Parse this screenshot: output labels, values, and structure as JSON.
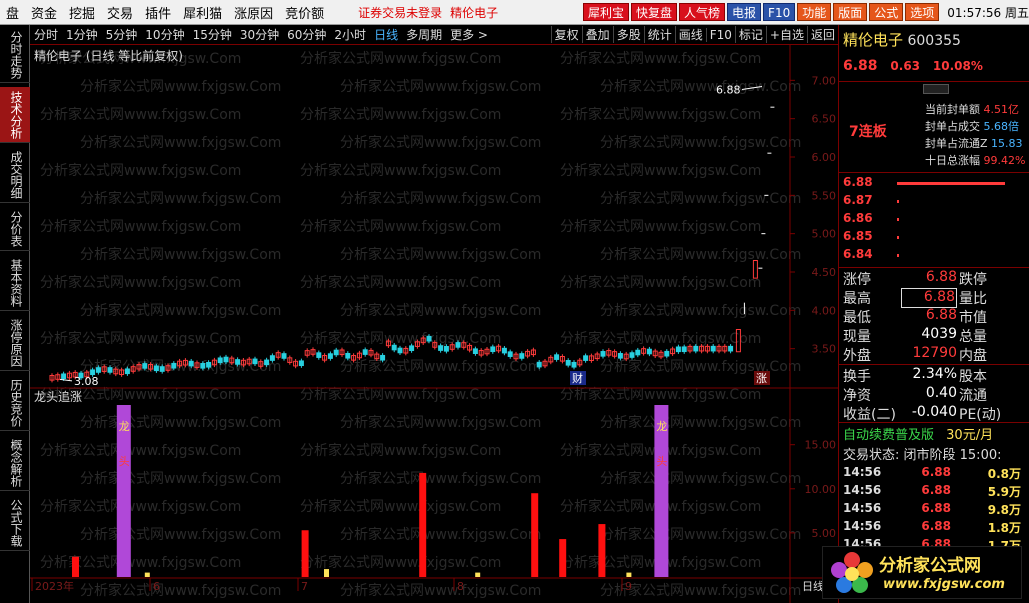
{
  "menu": {
    "items": [
      "盘",
      "资金",
      "挖掘",
      "交易",
      "插件",
      "犀利猫",
      "涨原因",
      "竞价额"
    ],
    "warning": "证券交易未登录",
    "stock_name": "精伦电子",
    "toolbar_buttons": [
      "犀利宝",
      "快复盘",
      "人气榜",
      "电报",
      "F10",
      "功能",
      "版面",
      "公式",
      "选项"
    ],
    "clock": "01:57:56 周五"
  },
  "left_tabs": [
    "分时走势",
    "技术分析",
    "成交明细",
    "分价表",
    "基本资料",
    "涨停原因",
    "历史竞价",
    "概念解析",
    "公式下载"
  ],
  "period_tabs": [
    "分时",
    "1分钟",
    "5分钟",
    "10分钟",
    "15分钟",
    "30分钟",
    "60分钟",
    "2小时",
    "日线",
    "多周期",
    "更多 >"
  ],
  "active_period": "日线",
  "right_buttons": [
    "复权",
    "叠加",
    "多股",
    "统计",
    "画线",
    "F10",
    "标记",
    "+自选",
    "返回"
  ],
  "chart": {
    "title": "精伦电子 (日线 等比前复权)",
    "sub_title": "龙头追涨",
    "label_high": "6.88",
    "label_low": "3.08",
    "marker_cai": "财",
    "marker_zhang": "涨",
    "marker_long": "龙",
    "marker_tou": "头",
    "x_labels": [
      "2023年",
      "6",
      "7",
      "8",
      "9"
    ],
    "x_right_label": "日线",
    "watermark": "分析家公式网www.fxjgsw.Com"
  },
  "chart_data": {
    "type": "candlestick",
    "price_axis": {
      "ticks": [
        3.5,
        4.0,
        4.5,
        5.0,
        5.5,
        6.0,
        6.5,
        7.0
      ],
      "range": [
        3.0,
        7.2
      ]
    },
    "indicator_axis": {
      "ticks": [
        5.0,
        10.0,
        15.0
      ],
      "range": [
        0,
        19.5
      ]
    },
    "indicator_bars": [
      {
        "pos": 0.5,
        "value": 2.3,
        "color": "red"
      },
      {
        "pos": 1.3,
        "value": 19.5,
        "color": "purple"
      },
      {
        "pos": 1.8,
        "value": 0.5,
        "color": "yellow"
      },
      {
        "pos": 4.6,
        "value": 5.3,
        "color": "red"
      },
      {
        "pos": 5.0,
        "value": 0.9,
        "color": "yellow"
      },
      {
        "pos": 6.7,
        "value": 11.8,
        "color": "red"
      },
      {
        "pos": 7.7,
        "value": 0.5,
        "color": "yellow"
      },
      {
        "pos": 8.7,
        "value": 9.5,
        "color": "red"
      },
      {
        "pos": 9.2,
        "value": 4.3,
        "color": "red"
      },
      {
        "pos": 9.9,
        "value": 6.0,
        "color": "red"
      },
      {
        "pos": 10.4,
        "value": 0.5,
        "color": "yellow"
      },
      {
        "pos": 10.9,
        "value": 19.5,
        "color": "purple"
      }
    ]
  },
  "quote": {
    "name": "精伦电子",
    "code": "600355",
    "price": "6.88",
    "change": "0.63",
    "pct": "10.08%",
    "lianban": "7连板",
    "seal": [
      {
        "label": "当前封单额",
        "value": "4.51亿"
      },
      {
        "label": "封单占成交",
        "value": "5.68倍"
      },
      {
        "label": "封单占流通Z",
        "value": "15.83"
      },
      {
        "label": "十日总涨幅",
        "value": "99.42%"
      }
    ],
    "asks": [
      "6.88",
      "6.87",
      "6.86",
      "6.85",
      "6.84"
    ],
    "rows": [
      {
        "k1": "涨停",
        "v1": "6.88",
        "k2": "跌停"
      },
      {
        "k1": "最高",
        "v1": "6.88",
        "k2": "量比"
      },
      {
        "k1": "最低",
        "v1": "6.88",
        "k2": "市值"
      },
      {
        "k1": "现量",
        "v1": "4039",
        "k2": "总量"
      },
      {
        "k1": "外盘",
        "v1": "12790",
        "k2": "内盘"
      },
      {
        "k1": "换手",
        "v1": "2.34%",
        "k2": "股本"
      },
      {
        "k1": "净资",
        "v1": "0.40",
        "k2": "流通"
      },
      {
        "k1": "收益(二)",
        "v1": "-0.040",
        "k2": "PE(动)"
      }
    ],
    "promo_left": "自动续费普及版",
    "promo_right": "30元/月",
    "trade_state": "交易状态: 闭市阶段 15:00:",
    "ticks": [
      {
        "t": "14:56",
        "p": "6.88",
        "v": "0.8万"
      },
      {
        "t": "14:56",
        "p": "6.88",
        "v": "5.9万"
      },
      {
        "t": "14:56",
        "p": "6.88",
        "v": "9.8万"
      },
      {
        "t": "14:56",
        "p": "6.88",
        "v": "1.8万"
      },
      {
        "t": "14:56",
        "p": "6.88",
        "v": "1.7万"
      }
    ]
  },
  "logo": {
    "line1": "分析家公式网",
    "line2": "www.fxjgsw.com"
  }
}
